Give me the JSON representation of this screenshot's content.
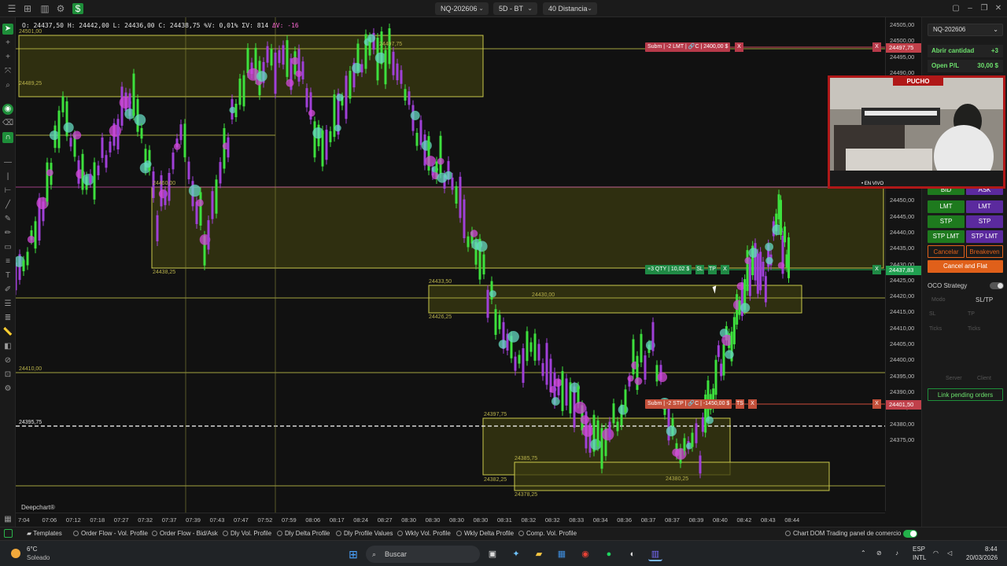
{
  "topbar": {
    "symbol": "NQ-202606",
    "timeframe": "5D - BT",
    "distance": "40 Distancia"
  },
  "ohlc": {
    "open": "O: 24437,50",
    "high": "H: 24442,00",
    "low": "L: 24436,00",
    "close": "C: 24438,75",
    "pct": "%V: 0,01%",
    "sv": "ΣV: 814",
    "dv": "ΔV: -16"
  },
  "zone_labels": [
    "24501,00",
    "24497,75",
    "24489,25",
    "24460,00",
    "24438,25",
    "24433,50",
    "24430,00",
    "24426,25",
    "24410,00",
    "24397,75",
    "24395,75",
    "24385,75",
    "24382,25",
    "24378,25",
    "24380,25"
  ],
  "orders": {
    "limit": {
      "tag": "Subm | -2 LMT | 🔗C | 2400,00 $",
      "close": "X",
      "price": "24497,75"
    },
    "position": {
      "tag": "+3 QTY | 10,02 $",
      "sl": "SL",
      "tp": "TP",
      "close": "X",
      "price": "24437,83"
    },
    "stop": {
      "tag": "Subm | -2 STP | 🔗C | -1450,00 $",
      "ts": "TS",
      "close": "X",
      "price": "24401,50"
    }
  },
  "price_axis": {
    "labels": [
      "24505,00",
      "24500,00",
      "24495,00",
      "24490,00",
      "24485,00",
      "24480,00",
      "24475,00",
      "24470,00",
      "24465,00",
      "24460,00",
      "24455,00",
      "24450,00",
      "24445,00",
      "24440,00",
      "24435,00",
      "24430,00",
      "24425,00",
      "24420,00",
      "24415,00",
      "24410,00",
      "24405,00",
      "24400,00",
      "24395,00",
      "24390,00",
      "24385,00",
      "24380,00",
      "24375,00"
    ]
  },
  "time_axis": {
    "labels": [
      "7:04",
      "07:06",
      "07:12",
      "07:18",
      "07:27",
      "07:32",
      "07:37",
      "07:39",
      "07:43",
      "07:47",
      "07:52",
      "07:59",
      "08:06",
      "08:17",
      "08:24",
      "08:27",
      "08:30",
      "08:30",
      "08:30",
      "08:30",
      "08:31",
      "08:32",
      "08:32",
      "08:33",
      "08:34",
      "08:36",
      "08:37",
      "08:37",
      "08:39",
      "08:40",
      "08:42",
      "08:43",
      "08:44"
    ]
  },
  "brand": "Deepchart®",
  "right_panel": {
    "symbol": "NQ-202606",
    "qty_label": "Abrir cantidad",
    "qty_value": "+3",
    "pl_label": "Open P/L",
    "pl_value": "30,00 $",
    "bid": "BID",
    "ask": "ASK",
    "lmt_buy": "LMT",
    "lmt_sell": "LMT",
    "stp_buy": "STP",
    "stp_sell": "STP",
    "stplmt_buy": "STP LMT",
    "stplmt_sell": "STP LMT",
    "cancel": "Cancelar",
    "breakeven": "Breakeven",
    "cancel_flat": "Cancel and Flat",
    "oco": "OCO Strategy",
    "mode_label": "Modo",
    "mode_value": "SL/TP",
    "sl": "SL",
    "tp": "TP",
    "ticks1": "Ticks",
    "ticks2": "Ticks",
    "server": "Server",
    "client": "Client",
    "link_pending": "Link pending orders"
  },
  "webcam": {
    "name": "PUCHO",
    "live": "• EN VIVO"
  },
  "templates_bar": {
    "templates": "Templates",
    "items": [
      "Order Flow - Vol. Profile",
      "Order Flow - Bid/Ask",
      "Dly Vol. Profile",
      "Dly Delta Profile",
      "Dly Profile Values",
      "Wkly Vol. Profile",
      "Wkly Delta Profile",
      "Comp. Vol. Profile"
    ],
    "chart_dom": "Chart DOM Trading",
    "panel": "panel de comercio"
  },
  "taskbar": {
    "weather_temp": "6°C",
    "weather_desc": "Soleado",
    "search": "Buscar",
    "lang1": "ESP",
    "lang2": "INTL",
    "time": "8:44",
    "date": "20/03/2026"
  },
  "colors": {
    "zone_fill": "#3a3a10",
    "zone_stroke": "#c9c84a",
    "bull": "#3de03d",
    "bear": "#a040d8",
    "bubble_buy": "#66d9c2",
    "bubble_sell": "#d24ad8",
    "order_red": "#c0404a",
    "position_green": "#20a050"
  }
}
